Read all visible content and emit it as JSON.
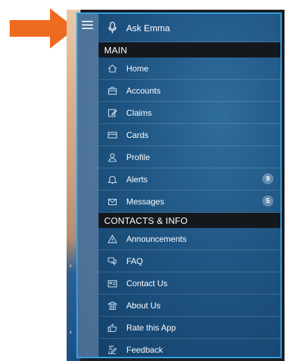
{
  "colors": {
    "accent_border": "#33a3ea",
    "arrow": "#ee6a1f",
    "section_bg": "#14181d"
  },
  "ask_emma": {
    "label": "Ask Emma",
    "icon": "microphone-icon"
  },
  "sections": {
    "main": "MAIN",
    "contacts": "CONTACTS & INFO"
  },
  "main_items": [
    {
      "label": "Home",
      "icon": "home-icon"
    },
    {
      "label": "Accounts",
      "icon": "briefcase-icon"
    },
    {
      "label": "Claims",
      "icon": "edit-document-icon"
    },
    {
      "label": "Cards",
      "icon": "card-icon"
    },
    {
      "label": "Profile",
      "icon": "person-icon"
    },
    {
      "label": "Alerts",
      "icon": "bell-icon",
      "badge": "9"
    },
    {
      "label": "Messages",
      "icon": "envelope-icon",
      "badge": "5"
    }
  ],
  "contact_items": [
    {
      "label": "Announcements",
      "icon": "warning-icon"
    },
    {
      "label": "FAQ",
      "icon": "chat-bubbles-icon"
    },
    {
      "label": "Contact Us",
      "icon": "contact-card-icon"
    },
    {
      "label": "About Us",
      "icon": "building-icon"
    },
    {
      "label": "Rate this App",
      "icon": "thumbs-up-icon"
    },
    {
      "label": "Feedback",
      "icon": "feedback-icon"
    }
  ]
}
